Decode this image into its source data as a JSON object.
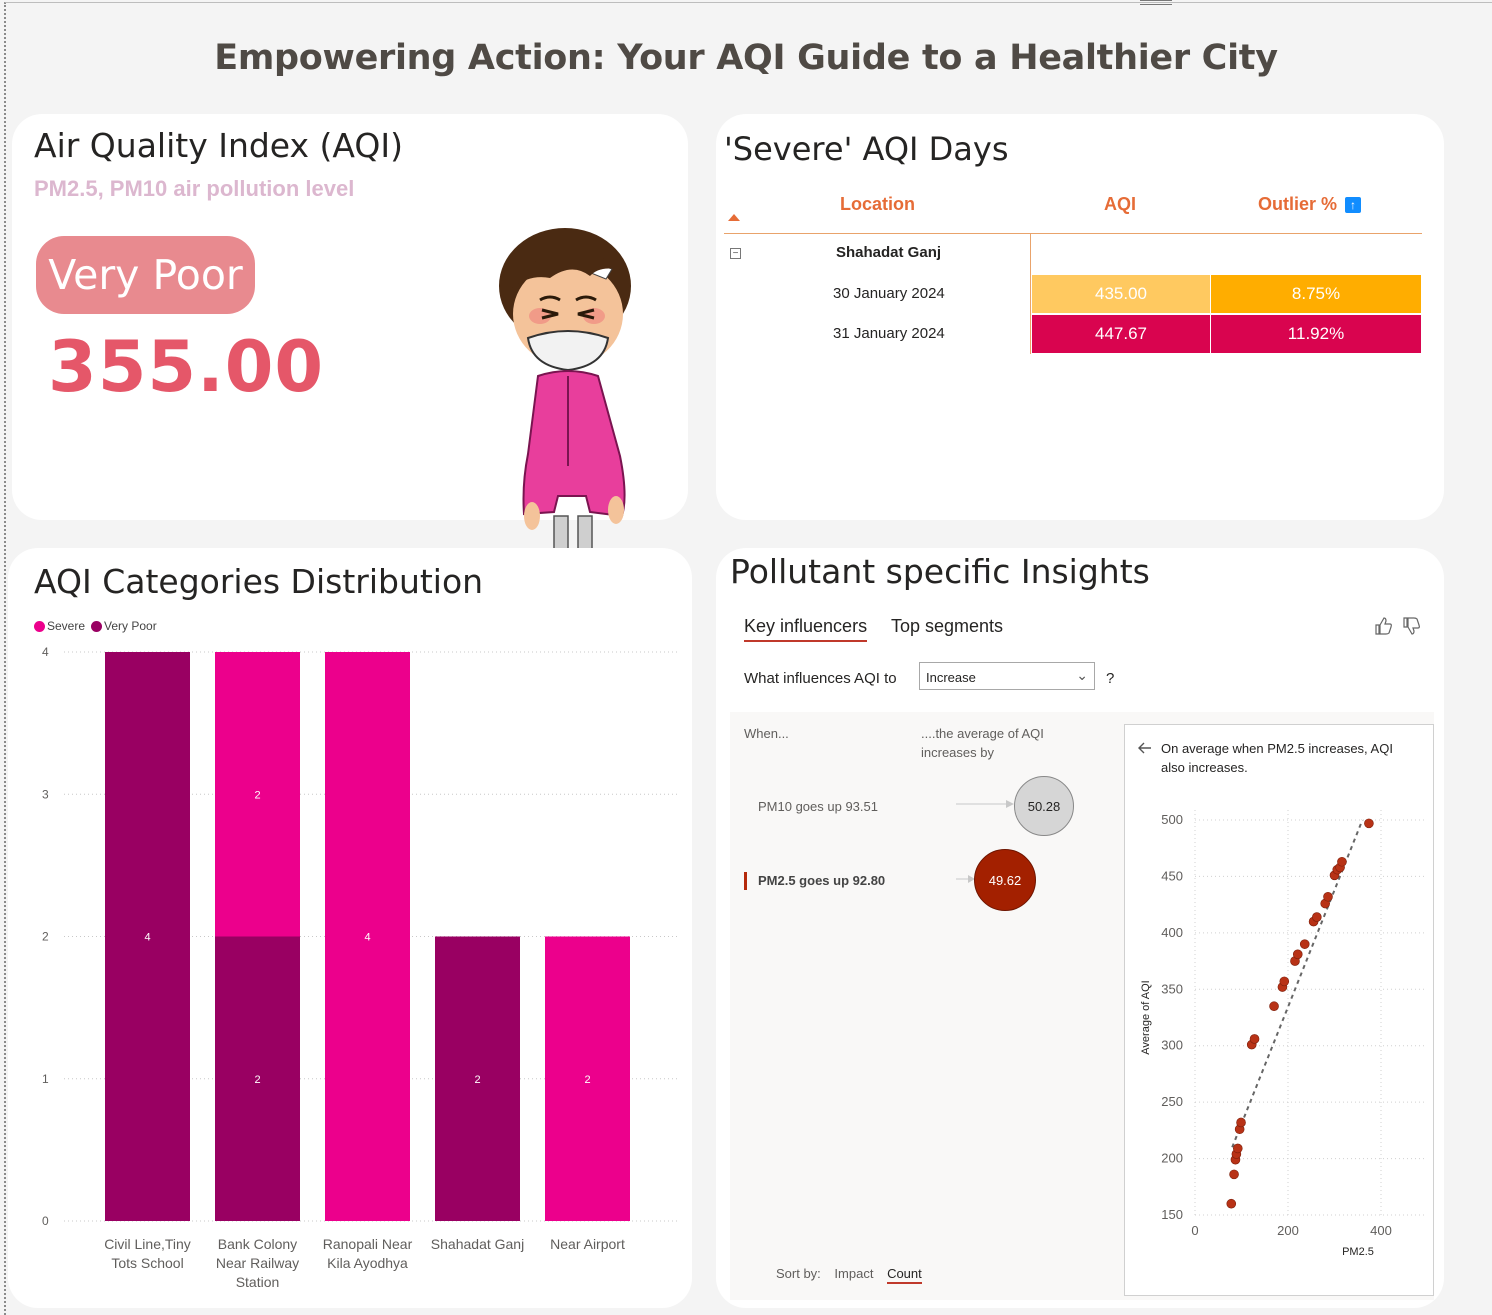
{
  "page_title": "Empowering Action: Your AQI Guide to a Healthier City",
  "aqi_card": {
    "title": "Air Quality Index (AQI)",
    "subtitle": "PM2.5, PM10 air pollution level",
    "category": "Very Poor",
    "value": "355.00"
  },
  "severe_days": {
    "title": "'Severe' AQI Days",
    "headers": {
      "location": "Location",
      "aqi": "AQI",
      "outlier": "Outlier %"
    },
    "group": "Shahadat Ganj",
    "rows": [
      {
        "date": "30 January 2024",
        "aqi": "435.00",
        "outlier": "8.75%"
      },
      {
        "date": "31 January 2024",
        "aqi": "447.67",
        "outlier": "11.92%"
      }
    ],
    "colors": {
      "aqi_row1": "#ffc960",
      "outlier_row1": "#ffad00",
      "row2": "#d9044f"
    }
  },
  "distribution": {
    "title": "AQI Categories Distribution",
    "legend": [
      {
        "label": "Severe",
        "color": "#ec008c"
      },
      {
        "label": "Very Poor",
        "color": "#990062"
      }
    ]
  },
  "chart_data": {
    "type": "bar",
    "stacked": true,
    "categories": [
      "Civil Line,Tiny Tots School",
      "Bank Colony Near Railway Station",
      "Ranopali Near Kila Ayodhya",
      "Shahadat Ganj",
      "Near Airport"
    ],
    "category_lines": [
      [
        "Civil Line,Tiny",
        "Tots School"
      ],
      [
        "Bank Colony",
        "Near Railway",
        "Station"
      ],
      [
        "Ranopali Near",
        "Kila Ayodhya"
      ],
      [
        "Shahadat Ganj"
      ],
      [
        "Near Airport"
      ]
    ],
    "series": [
      {
        "name": "Severe",
        "color": "#ec008c",
        "values": [
          0,
          2,
          4,
          0,
          2
        ]
      },
      {
        "name": "Very Poor",
        "color": "#990062",
        "values": [
          4,
          2,
          0,
          2,
          0
        ]
      }
    ],
    "yticks": [
      "0",
      "1",
      "2",
      "3",
      "4"
    ],
    "ylim": [
      0,
      4
    ],
    "grid": true,
    "legend_position": "top-left"
  },
  "insights": {
    "title": "Pollutant specific Insights",
    "tabs": [
      "Key influencers",
      "Top segments"
    ],
    "question_prefix": "What influences AQI to",
    "dropdown_value": "Increase",
    "question_suffix": "?",
    "when_label": "When...",
    "avg_label_1": "....the average of AQI",
    "avg_label_2": "increases by",
    "influencers": [
      {
        "label": "PM10 goes up 93.51",
        "value": "50.28"
      },
      {
        "label": "PM2.5 goes up 92.80",
        "value": "49.62"
      }
    ],
    "scatter_note_1": "On average when PM2.5 increases, AQI",
    "scatter_note_2": "also increases.",
    "scatter": {
      "xlabel": "PM2.5",
      "ylabel": "Average of AQI",
      "xticks": [
        "0",
        "200",
        "400"
      ],
      "yticks": [
        "500",
        "450",
        "400",
        "350",
        "300",
        "250",
        "200",
        "150"
      ],
      "xlim": [
        0,
        400
      ],
      "ylim": [
        150,
        500
      ],
      "points": [
        [
          78,
          160
        ],
        [
          84,
          186
        ],
        [
          87,
          199
        ],
        [
          89,
          204
        ],
        [
          92,
          209
        ],
        [
          96,
          226
        ],
        [
          99,
          232
        ],
        [
          122,
          301
        ],
        [
          128,
          306
        ],
        [
          170,
          335
        ],
        [
          188,
          352
        ],
        [
          192,
          357
        ],
        [
          215,
          375
        ],
        [
          221,
          381
        ],
        [
          236,
          390
        ],
        [
          255,
          410
        ],
        [
          262,
          414
        ],
        [
          280,
          426
        ],
        [
          286,
          432
        ],
        [
          300,
          451
        ],
        [
          306,
          456
        ],
        [
          312,
          458
        ],
        [
          316,
          463
        ],
        [
          374,
          497
        ]
      ],
      "trend": [
        [
          80,
          210
        ],
        [
          360,
          500
        ]
      ]
    },
    "sort_label": "Sort by:",
    "sort_impact": "Impact",
    "sort_count": "Count"
  }
}
